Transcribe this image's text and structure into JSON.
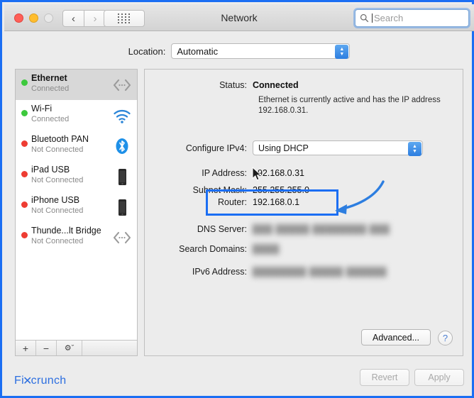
{
  "window": {
    "title": "Network",
    "traffic_lights": [
      "close",
      "minimize",
      "zoom"
    ],
    "nav_back": "‹",
    "nav_forward": "›",
    "show_all_icon": "grid-icon",
    "search": {
      "placeholder": "Search",
      "value": "",
      "icon": "search-icon"
    }
  },
  "location": {
    "label": "Location:",
    "value": "Automatic"
  },
  "sidebar": {
    "services": [
      {
        "name": "Ethernet",
        "state": "Connected",
        "status": "green",
        "icon": "ethernet-icon",
        "selected": true
      },
      {
        "name": "Wi-Fi",
        "state": "Connected",
        "status": "green",
        "icon": "wifi-icon",
        "selected": false
      },
      {
        "name": "Bluetooth PAN",
        "state": "Not Connected",
        "status": "red",
        "icon": "bluetooth-icon",
        "selected": false
      },
      {
        "name": "iPad USB",
        "state": "Not Connected",
        "status": "red",
        "icon": "ipad-icon",
        "selected": false
      },
      {
        "name": "iPhone USB",
        "state": "Not Connected",
        "status": "red",
        "icon": "iphone-icon",
        "selected": false
      },
      {
        "name": "Thunde...lt Bridge",
        "state": "Not Connected",
        "status": "red",
        "icon": "ethernet-icon",
        "selected": false
      }
    ],
    "toolbar": {
      "add": "+",
      "remove": "−",
      "actions": "⚙",
      "actions_chevron": "ˇ"
    }
  },
  "detail": {
    "status_label": "Status:",
    "status_value": "Connected",
    "status_description": "Ethernet is currently active and has the IP address 192.168.0.31.",
    "configure_label": "Configure IPv4:",
    "configure_value": "Using DHCP",
    "fields": [
      {
        "label": "IP Address:",
        "value": "192.168.0.31",
        "redacted": false
      },
      {
        "label": "Subnet Mask:",
        "value": "255.255.255.0",
        "redacted": false
      },
      {
        "label": "Router:",
        "value": "192.168.0.1",
        "redacted": false
      },
      {
        "label": "DNS Server:",
        "value": "███  █████   ████████  ███",
        "redacted": true
      },
      {
        "label": "Search Domains:",
        "value": "████",
        "redacted": true
      },
      {
        "label": "IPv6 Address:",
        "value": "████████  █████  ██████",
        "redacted": true
      }
    ],
    "advanced_label": "Advanced...",
    "help_label": "?"
  },
  "footer": {
    "revert_label": "Revert",
    "apply_label": "Apply"
  },
  "watermark": {
    "prefix": "Fi",
    "x": "✕",
    "suffix": "crunch"
  },
  "annotation": {
    "highlight_color": "#1B6EF3",
    "arrow_color": "#2D7EE0",
    "frame_color": "#1B6EF3",
    "highlighted_field": "Router"
  },
  "colors": {
    "status_connected": "#3DC93D",
    "status_disconnected": "#EE3C33",
    "accent_blue": "#2D7EE0",
    "window_bg": "#ECECEC"
  }
}
